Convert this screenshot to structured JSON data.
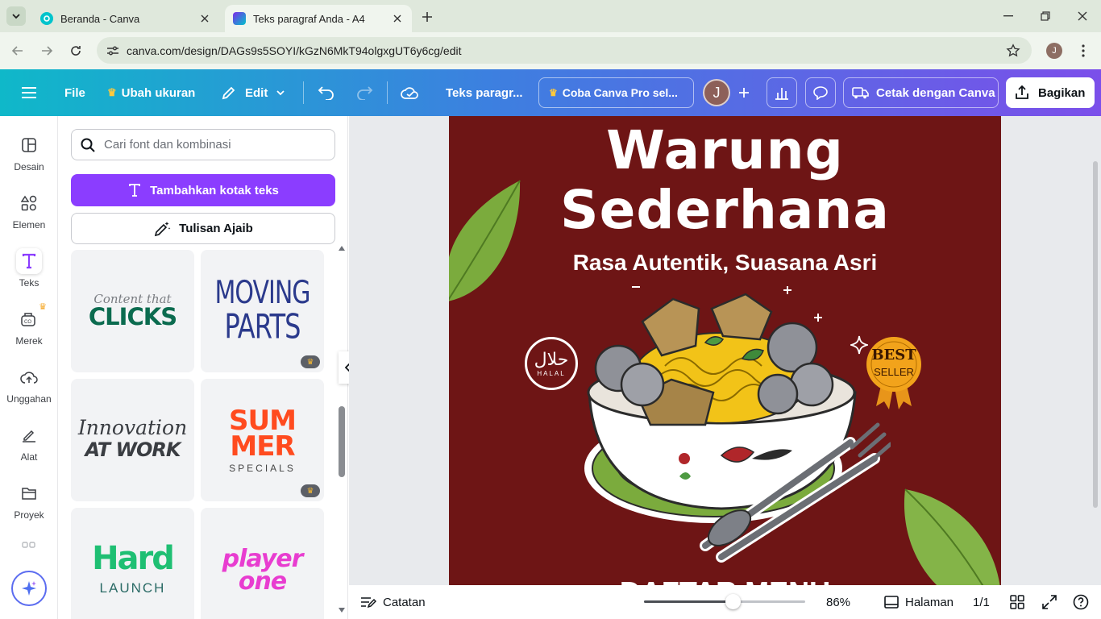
{
  "browser": {
    "tabs": [
      {
        "title": "Beranda - Canva",
        "active": false
      },
      {
        "title": "Teks paragraf Anda - A4",
        "active": true
      }
    ],
    "url": "canva.com/design/DAGs9s5SOYI/kGzN6MkT94olgxgUT6y6cg/edit",
    "profile_initial": "J"
  },
  "header": {
    "menu_icon": "hamburger-icon",
    "file": "File",
    "resize": "Ubah ukuran",
    "edit": "Edit",
    "doc_title": "Teks paragr...",
    "pro_cta": "Coba Canva Pro sel...",
    "avatar_initial": "J",
    "print": "Cetak dengan Canva",
    "share": "Bagikan"
  },
  "rail": {
    "items": [
      {
        "label": "Desain",
        "icon": "design-icon"
      },
      {
        "label": "Elemen",
        "icon": "elements-icon"
      },
      {
        "label": "Teks",
        "icon": "text-icon"
      },
      {
        "label": "Merek",
        "icon": "brand-icon"
      },
      {
        "label": "Unggahan",
        "icon": "upload-icon"
      },
      {
        "label": "Alat",
        "icon": "tools-icon"
      },
      {
        "label": "Proyek",
        "icon": "projects-icon"
      }
    ],
    "active": "Teks"
  },
  "panel": {
    "search_placeholder": "Cari font dan kombinasi",
    "add_text_button": "Tambahkan kotak teks",
    "magic_write_button": "Tulisan Ajaib",
    "cards": [
      {
        "line1": "Content that",
        "line2": "CLICKS",
        "pro": false
      },
      {
        "line1": "MOVING",
        "line2": "PARTS",
        "pro": true
      },
      {
        "line1": "Innovation",
        "line2": "AT WORK",
        "pro": false
      },
      {
        "line1": "SUM",
        "line2": "MER",
        "line3": "SPECIALS",
        "pro": true
      },
      {
        "line1": "Hard",
        "line2": "LAUNCH",
        "pro": false
      },
      {
        "line1": "player",
        "line2": "one",
        "pro": false
      }
    ]
  },
  "design": {
    "title_line1": "Warung",
    "title_line2": "Sederhana",
    "subtitle": "Rasa Autentik, Suasana Asri",
    "halal_text": "HALAL",
    "badge_line1": "BEST",
    "badge_line2": "SELLER",
    "bottom_text": "DAFTAR MENU",
    "colors": {
      "background": "#6e1515",
      "leaf": "#7bab3d",
      "badge": "#f2a31b"
    }
  },
  "status": {
    "notes": "Catatan",
    "zoom": "86%",
    "zoom_fraction": 0.55,
    "pages": "Halaman",
    "page_count": "1/1"
  }
}
